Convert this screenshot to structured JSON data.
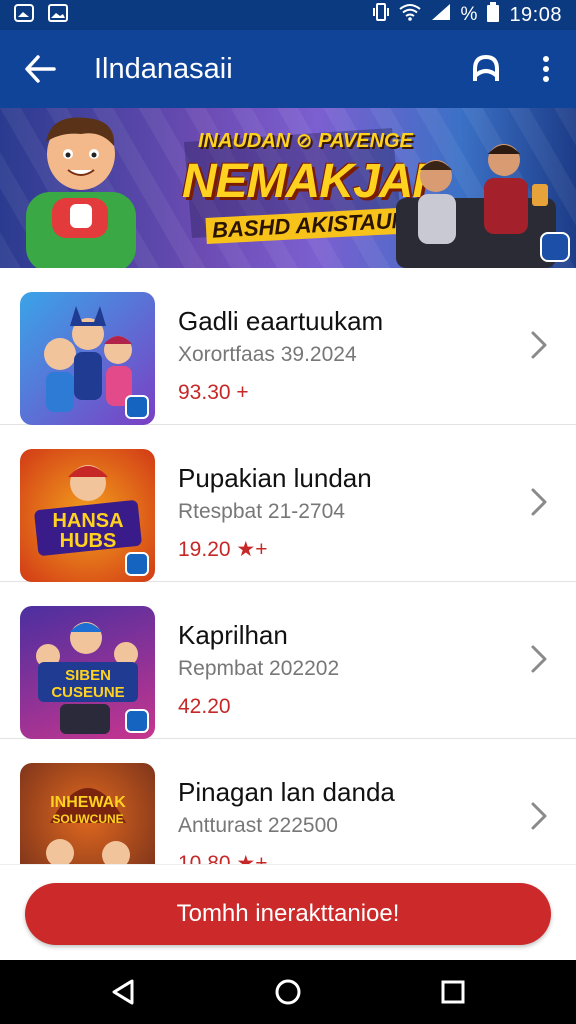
{
  "status_bar": {
    "time": "19:08",
    "battery_text": "%",
    "icons": [
      "gallery-notification-icon",
      "image-notification-icon",
      "vibrate-icon",
      "wifi-icon",
      "signal-icon",
      "battery-icon"
    ]
  },
  "app_bar": {
    "title": "Ilndanasaii",
    "back_icon": "arrow-left-icon",
    "action_icon": "user-icon",
    "menu_icon": "more-vert-icon"
  },
  "banner": {
    "title_top": "INAUDAN ⊘ PAVENGE",
    "title_main": "NEMAKJAI",
    "title_sub": "BASHD AKISTAUNE!"
  },
  "list": {
    "items": [
      {
        "title": "Gadli eaartuukam",
        "subtitle": "Xorortfaas 39.2024",
        "price": "93.30 +",
        "thumb_colors": [
          "#3aa4e8",
          "#7b3fc4"
        ]
      },
      {
        "title": "Pupakian lundan",
        "subtitle": "Rtespbat 21-2704",
        "price": "19.20 ★+",
        "thumb_text": "HANSA HUBS",
        "thumb_colors": [
          "#f2a01d",
          "#d23a16"
        ]
      },
      {
        "title": "Kaprilhan",
        "subtitle": "Repmbat 202202",
        "price": "42.20",
        "thumb_text": "SIBEN CUSEUNE",
        "thumb_colors": [
          "#4b2fa0",
          "#c7358e"
        ]
      },
      {
        "title": "Pinagan lan danda",
        "subtitle": "Antturast 222500",
        "price": "10.80 ★+",
        "thumb_text": "INHEWAK SOUWCUNE",
        "thumb_colors": [
          "#e0681f",
          "#6a2a1a"
        ]
      }
    ],
    "chevron_icon": "chevron-right-icon"
  },
  "cta": {
    "label": "Tomhh inerakttanioe!",
    "color": "#cc2a2a"
  },
  "nav_bar": {
    "icons": [
      "nav-back-icon",
      "nav-home-icon",
      "nav-recents-icon"
    ]
  },
  "colors": {
    "app_bar": "#0f4499",
    "status_bar": "#0c3a80",
    "price": "#c62828"
  }
}
